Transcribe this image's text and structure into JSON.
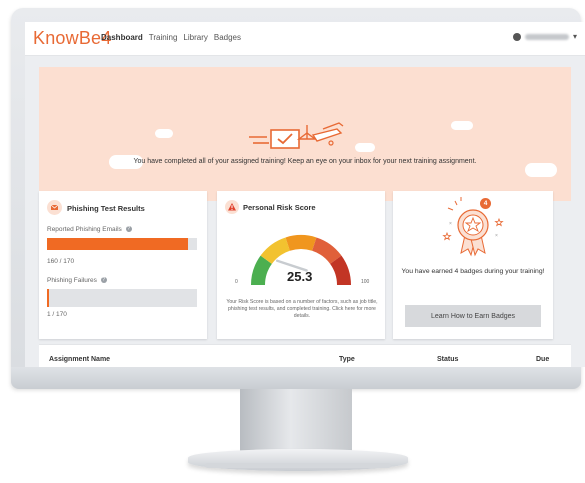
{
  "nav": {
    "logo": "KnowBe4",
    "links": [
      "Dashboard",
      "Training",
      "Library",
      "Badges"
    ],
    "user_caret": "▾"
  },
  "banner": {
    "message": "You have completed all of your assigned training! Keep an eye on your inbox for your next training assignment."
  },
  "phishing": {
    "title": "Phishing Test Results",
    "reported_label": "Reported Phishing Emails",
    "reported_value": "160 / 170",
    "reported_fraction": 0.94,
    "failures_label": "Phishing Failures",
    "failures_value": "1 / 170",
    "failures_fraction": 0.006
  },
  "risk": {
    "title": "Personal Risk Score",
    "score": "25.3",
    "min_label": "0",
    "max_label": "100",
    "score_fraction": 0.253,
    "note": "Your Risk Score is based on a number of factors, such as job title, phishing test results, and completed training. Click here for more details."
  },
  "badges": {
    "count_text": "You have earned 4 badges during your training!",
    "badge_count": "4",
    "button_label": "Learn How to Earn Badges"
  },
  "table": {
    "columns": [
      "Assignment Name",
      "Type",
      "Status",
      "Due"
    ]
  },
  "colors": {
    "brand": "#e86a35",
    "banner_bg": "#fcdfd1",
    "bar_fill": "#f06a23",
    "gauge": [
      "#4caf50",
      "#f2c230",
      "#f0961e",
      "#e0603a",
      "#c23525"
    ]
  }
}
